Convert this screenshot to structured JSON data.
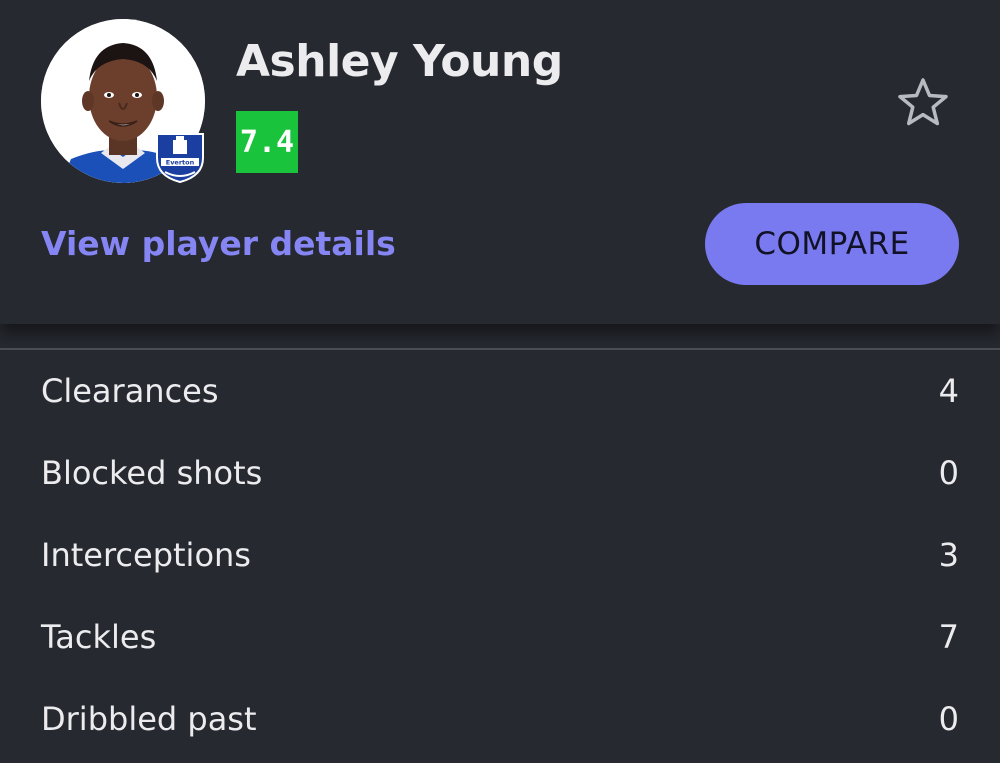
{
  "player": {
    "name": "Ashley Young",
    "rating": "7.4",
    "rating_color": "#19c33c",
    "avatar_icon": "player-photo",
    "club_badge_icon": "everton-crest",
    "club_badge_text": "Everton"
  },
  "actions": {
    "view_details_label": "View player details",
    "compare_label": "COMPARE",
    "favorite_icon": "star-outline-icon"
  },
  "colors": {
    "background": "#262930",
    "accent": "#7a7af0",
    "link": "#8585f4"
  },
  "stats": [
    {
      "label": "Clearances",
      "value": "4"
    },
    {
      "label": "Blocked shots",
      "value": "0"
    },
    {
      "label": "Interceptions",
      "value": "3"
    },
    {
      "label": "Tackles",
      "value": "7"
    },
    {
      "label": "Dribbled past",
      "value": "0"
    }
  ]
}
